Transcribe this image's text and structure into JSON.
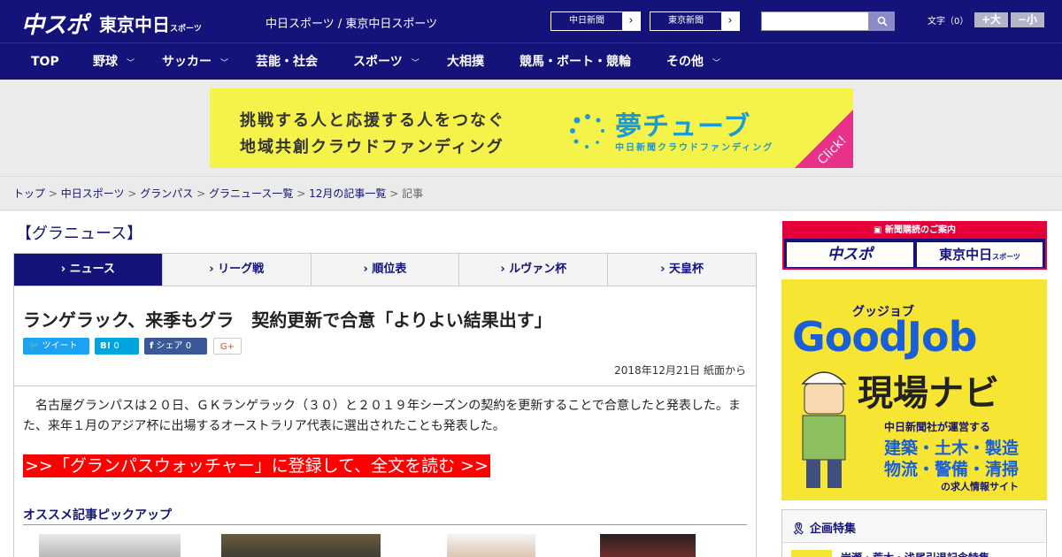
{
  "header": {
    "logo_main": "中スポ",
    "logo_tokyo": "東京中日",
    "logo_tokyo_small": "スポーツ",
    "site_names": "中日スポーツ / 東京中日スポーツ",
    "ext_link_1": "中日新聞",
    "ext_link_2": "東京新聞",
    "font_size_label": "文字（0）",
    "font_bigger": "+大",
    "font_smaller": "−小"
  },
  "nav": [
    {
      "label": "TOP",
      "has_menu": false
    },
    {
      "label": "野球",
      "has_menu": true
    },
    {
      "label": "サッカー",
      "has_menu": true
    },
    {
      "label": "芸能・社会",
      "has_menu": false
    },
    {
      "label": "スポーツ",
      "has_menu": true
    },
    {
      "label": "大相撲",
      "has_menu": false
    },
    {
      "label": "競馬・ボート・競輪",
      "has_menu": false
    },
    {
      "label": "その他",
      "has_menu": true
    }
  ],
  "banner": {
    "line1": "挑戦する人と応援する人をつなぐ",
    "line2": "地域共創クラウドファンディング",
    "brand": "夢チューブ",
    "brand_sub": "中日新聞クラウドファンディング",
    "click": "Click!"
  },
  "breadcrumb": {
    "items": [
      "トップ",
      "中日スポーツ",
      "グランパス",
      "グラニュース一覧",
      "12月の記事一覧"
    ],
    "current": "記事",
    "separator": ">"
  },
  "section_title": "【グラニュース】",
  "tabs": [
    {
      "label": "ニュース",
      "active": true
    },
    {
      "label": "リーグ戦",
      "active": false
    },
    {
      "label": "順位表",
      "active": false
    },
    {
      "label": "ルヴァン杯",
      "active": false
    },
    {
      "label": "天皇杯",
      "active": false
    }
  ],
  "article": {
    "headline": "ランゲラック、来季もグラ　契約更新で合意「よりよい結果出す」",
    "share": {
      "tweet": "ツイート",
      "hatena_count": "0",
      "facebook": "シェア",
      "facebook_count": "0",
      "google": "G+"
    },
    "dateline": "2018年12月21日 紙面から",
    "body": "名古屋グランパスは２０日、ＧＫランゲラック（３０）と２０１９年シーズンの契約を更新することで合意したと発表した。また、来年１月のアジア杯に出場するオーストラリア代表に選出されたことも発表した。",
    "cta": ">>「グランパスウォッチャー」に登録して、全文を読む >>",
    "pickup_title": "オススメ記事ピックアップ"
  },
  "sidebar": {
    "subscribe_head": "新聞購読のご案内",
    "subscribe_chuspo": "中スポ",
    "subscribe_tokyo": "東京中日",
    "subscribe_tokyo_small": "スポーツ",
    "goodjob_kana": "グッジョブ",
    "goodjob_title": "GoodJob",
    "goodjob_sub": "現場ナビ",
    "goodjob_desc1": "中日新聞社が運営する",
    "goodjob_desc2": "建築・土木・製造",
    "goodjob_desc3": "物流・警備・清掃",
    "goodjob_desc4": "の求人情報サイト",
    "feature_title": "企画特集",
    "feature_item": "岩瀬・荒木・浅尾引退記念特集"
  },
  "colors": {
    "navy": "#13137a",
    "red": "#ff0000",
    "banner_yellow": "#f5f24a",
    "twitter": "#1da1f2",
    "hatena": "#00a4de",
    "facebook": "#3b5998"
  }
}
